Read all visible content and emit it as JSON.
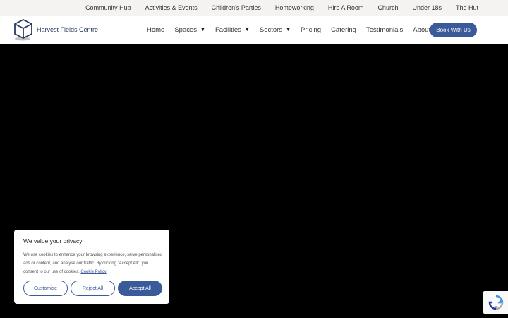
{
  "topbar": {
    "links": [
      "Community Hub",
      "Activities & Events",
      "Children's Parties",
      "Homeworking",
      "Hire A Room",
      "Church",
      "Under 18s",
      "The Hut"
    ]
  },
  "header": {
    "logo_text": "Harvest Fields Centre",
    "nav": {
      "home": "Home",
      "spaces": "Spaces",
      "facilities": "Facilities",
      "sectors": "Sectors",
      "pricing": "Pricing",
      "catering": "Catering",
      "testimonials": "Testimonials",
      "about": "About"
    },
    "book_label": "Book With Us"
  },
  "cookie": {
    "title": "We value your privacy",
    "text": "We use cookies to enhance your browsing experience, serve personalised ads or content, and analyse our traffic. By clicking \"Accept All\", you consent to our use of cookies.",
    "policy_link": "Cookie Policy",
    "customise": "Customise",
    "reject": "Reject All",
    "accept": "Accept All"
  },
  "colors": {
    "accent": "#3b5a9a",
    "hero": "#000000"
  }
}
